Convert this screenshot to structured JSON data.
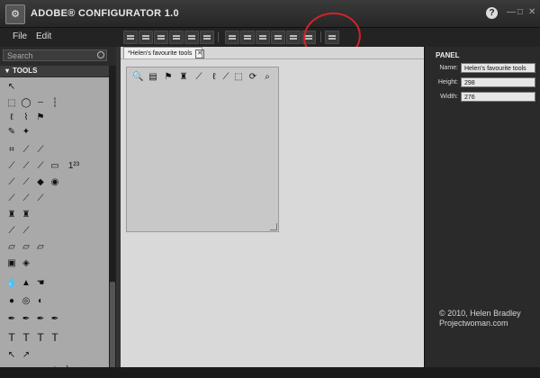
{
  "titlebar": {
    "title": "ADOBE® CONFIGURATOR 1.0",
    "help": "?",
    "minimize": "—",
    "maximize": "□",
    "close": "✕"
  },
  "menu": {
    "file": "File",
    "edit": "Edit"
  },
  "left": {
    "search_placeholder": "Search",
    "section": "TOOLS"
  },
  "document": {
    "tab_label": "*Helen's favourite tools",
    "close": "✕"
  },
  "props": {
    "header": "PANEL",
    "name_label": "Name:",
    "name_value": "Helen's favourite tools",
    "height_label": "Height:",
    "height_value": "298",
    "width_label": "Width:",
    "width_value": "276"
  },
  "watermark": {
    "line1": "© 2010, Helen Bradley",
    "line2": "Projectwoman.com"
  },
  "colors": {
    "accent_circle": "#d2232a",
    "canvas": "#d6d6d6",
    "panel_bg": "#2a2a2a"
  },
  "tool_icons": [
    "move-icon",
    "marquee-icon",
    "lasso-icon",
    "magic-wand-icon",
    "crop-icon",
    "eyedropper-icon",
    "healing-icon",
    "brush-icon",
    "stamp-icon",
    "history-brush-icon",
    "eraser-icon",
    "gradient-icon",
    "blur-icon",
    "dodge-icon",
    "pen-icon",
    "type-icon",
    "path-select-icon",
    "shape-icon"
  ]
}
